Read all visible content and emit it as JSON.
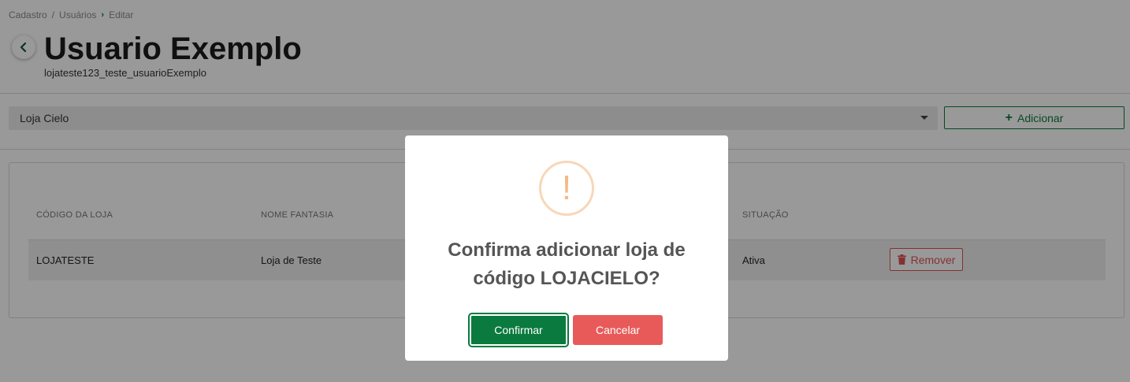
{
  "breadcrumb": {
    "items": [
      "Cadastro",
      "Usuários",
      "Editar"
    ],
    "separator": "/"
  },
  "header": {
    "title": "Usuario Exemplo",
    "subtitle": "lojateste123_teste_usuarioExemplo"
  },
  "store_select": {
    "value": "Loja Cielo"
  },
  "add_button": {
    "label": "Adicionar"
  },
  "table": {
    "columns": [
      "CÓDIGO DA LOJA",
      "NOME FANTASIA",
      "SITUAÇÃO"
    ],
    "rows": [
      {
        "code": "LOJATESTE",
        "name": "Loja de Teste",
        "status": "Ativa",
        "action": "Remover"
      }
    ]
  },
  "modal": {
    "icon": "!",
    "title": "Confirma adicionar loja de código LOJACIELO?",
    "confirm_label": "Confirmar",
    "cancel_label": "Cancelar"
  },
  "colors": {
    "primary": "#0a7a3e",
    "danger": "#e85a5a",
    "warning": "#f5b985"
  }
}
